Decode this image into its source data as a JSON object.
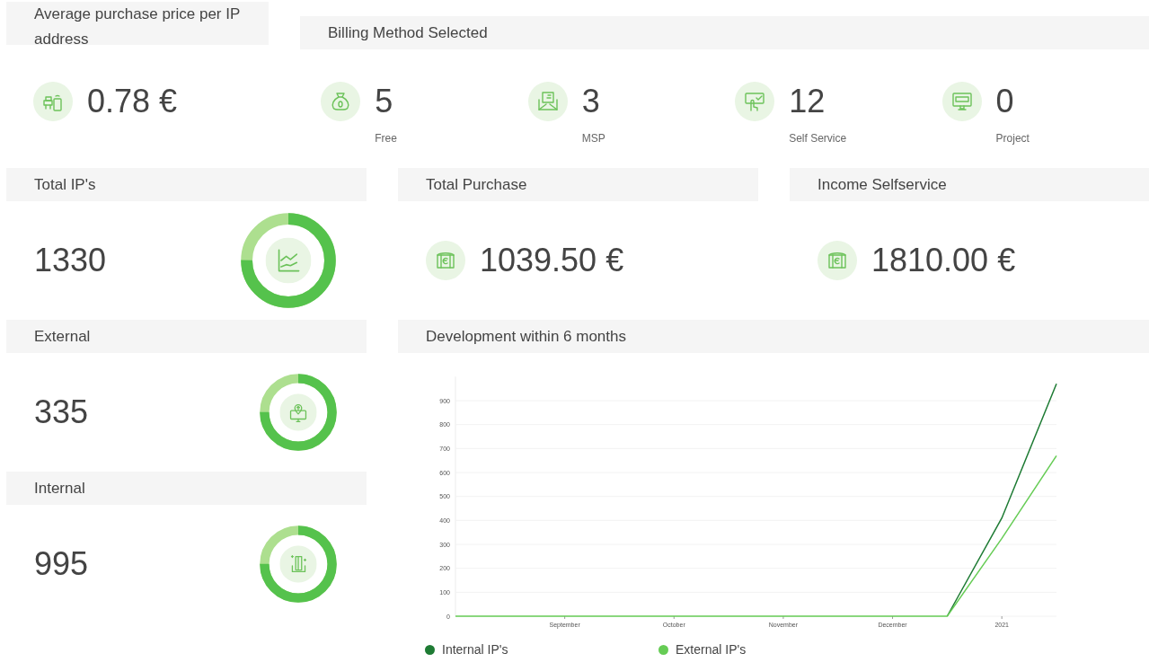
{
  "average_price": {
    "title": "Average purchase price per IP address",
    "value": "0.78 €"
  },
  "billing_method": {
    "title": "Billing Method Selected",
    "items": [
      {
        "value": "5",
        "label": "Free"
      },
      {
        "value": "3",
        "label": "MSP"
      },
      {
        "value": "12",
        "label": "Self Service"
      },
      {
        "value": "0",
        "label": "Project"
      }
    ]
  },
  "cards": [
    {
      "title": "Total IP's",
      "value": "1330",
      "kind": "donut",
      "level": 0.75
    },
    {
      "title": "Total Purchase",
      "value": "1039.50 €",
      "kind": "icon"
    },
    {
      "title": "Income Selfservice",
      "value": "1810.00 €",
      "kind": "icon"
    }
  ],
  "ip_cards": [
    {
      "title": "External",
      "value": "335",
      "level": 0.75
    },
    {
      "title": "Internal",
      "value": "995",
      "level": 0.75
    }
  ],
  "development": {
    "title": "Development within 6 months",
    "chart_data": {
      "type": "line",
      "categories": [
        null,
        null,
        "September",
        null,
        "October",
        null,
        "November",
        null,
        "December",
        null,
        "2021",
        null
      ],
      "ylim": [
        0,
        1000
      ],
      "grid": true,
      "yticks": [
        0,
        100,
        200,
        300,
        400,
        500,
        600,
        700,
        800,
        900
      ],
      "series": [
        {
          "name": "Internal IP's",
          "color": "#1e7b34",
          "values": [
            null,
            null,
            null,
            null,
            null,
            null,
            null,
            null,
            null,
            0,
            410,
            970
          ]
        },
        {
          "name": "External IP's",
          "color": "#66cc55",
          "values": [
            0,
            0,
            0,
            0,
            0,
            0,
            0,
            0,
            0,
            0,
            325,
            670
          ]
        }
      ]
    }
  }
}
